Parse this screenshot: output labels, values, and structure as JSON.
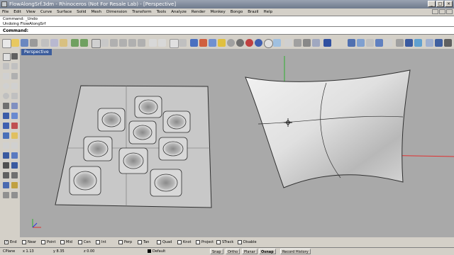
{
  "window": {
    "title": "FlowAlongSrf.3dm - Rhinoceros (Not For Resale Lab) - [Perspective]"
  },
  "menu": [
    "File",
    "Edit",
    "View",
    "Curve",
    "Surface",
    "Solid",
    "Mesh",
    "Dimension",
    "Transform",
    "Tools",
    "Analyze",
    "Render",
    "Monkey",
    "Bongo",
    "Brazil",
    "Help"
  ],
  "history": {
    "line1": "Command: _Undo",
    "line2": "Undoing FlowAlongSrf"
  },
  "command": {
    "label": "Command:"
  },
  "viewport": {
    "name": "Perspective"
  },
  "axes": {
    "x_color": "#e03030",
    "y_color": "#30b030",
    "z_color": "#3030e0"
  },
  "osnaps": [
    {
      "label": "End",
      "checked": true
    },
    {
      "label": "Near",
      "checked": false
    },
    {
      "label": "Point",
      "checked": false
    },
    {
      "label": "Mid",
      "checked": false
    },
    {
      "label": "Cen",
      "checked": false
    },
    {
      "label": "Int",
      "checked": false
    },
    {
      "label": "Perp",
      "checked": false
    },
    {
      "label": "Tan",
      "checked": false
    },
    {
      "label": "Quad",
      "checked": false
    },
    {
      "label": "Knot",
      "checked": false
    },
    {
      "label": "Project",
      "checked": false
    },
    {
      "label": "STrack",
      "checked": false
    },
    {
      "label": "Disable",
      "checked": false
    }
  ],
  "status": {
    "cplane": "CPlane",
    "x": "x 1.13",
    "y": "y 8.35",
    "z": "z 0.00",
    "layer": "Default",
    "buttons": [
      "Snap",
      "Ortho",
      "Planar",
      "Osnap",
      "Record History"
    ]
  }
}
